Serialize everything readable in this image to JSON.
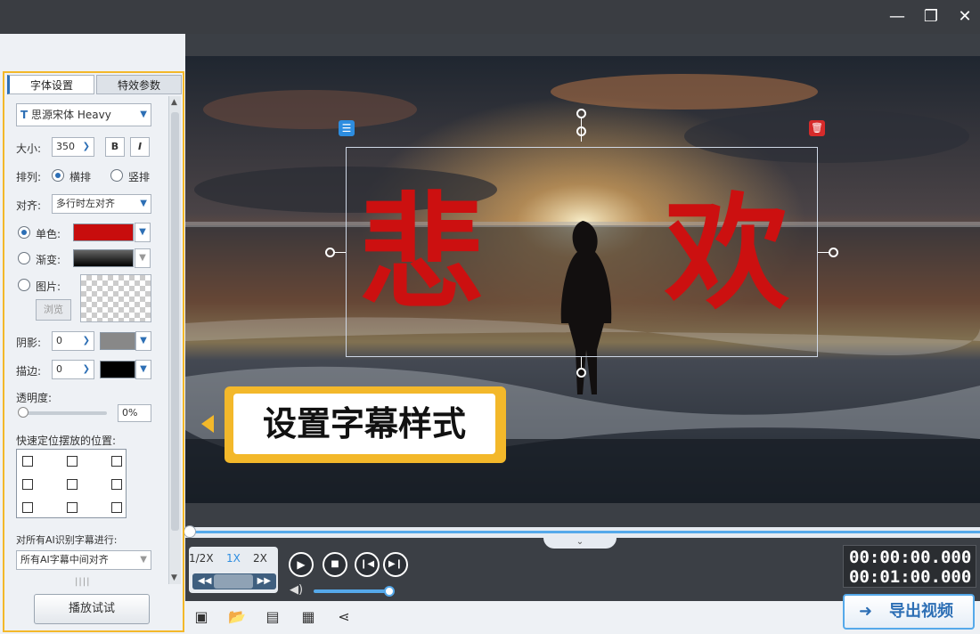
{
  "window": {
    "minimize": "—",
    "restore": "❐",
    "close": "✕"
  },
  "tabs": [
    "字体设置",
    "特效参数"
  ],
  "font": {
    "icon": "T",
    "name": "思源宋体 Heavy"
  },
  "size": {
    "label": "大小:",
    "value": "350",
    "bold": "B",
    "italic": "I"
  },
  "layout": {
    "label": "排列:",
    "horizontal": "横排",
    "vertical": "竖排"
  },
  "align": {
    "label": "对齐:",
    "value": "多行时左对齐"
  },
  "fill": {
    "solid": "单色:",
    "gradient": "渐变:",
    "image": "图片:",
    "browse": "浏览"
  },
  "shadow": {
    "label": "阴影:",
    "value": "0"
  },
  "stroke": {
    "label": "描边:",
    "value": "0"
  },
  "opacity": {
    "label": "透明度:",
    "value": "0%"
  },
  "position": {
    "label": "快速定位摆放的位置:"
  },
  "ai": {
    "label": "对所有AI识别字幕进行:",
    "value": "所有AI字幕中间对齐"
  },
  "preview_button": "播放试试",
  "subtitle": {
    "left": "悲",
    "right": "欢"
  },
  "callout": "设置字幕样式",
  "speed": [
    "1/2X",
    "1X",
    "2X"
  ],
  "time": {
    "current": "00:00:00.000",
    "total": "00:01:00.000"
  },
  "export": "导出视频",
  "colors": {
    "accent": "#f3b82a",
    "subtitle": "#cc1010",
    "brand": "#2d6fb5"
  }
}
